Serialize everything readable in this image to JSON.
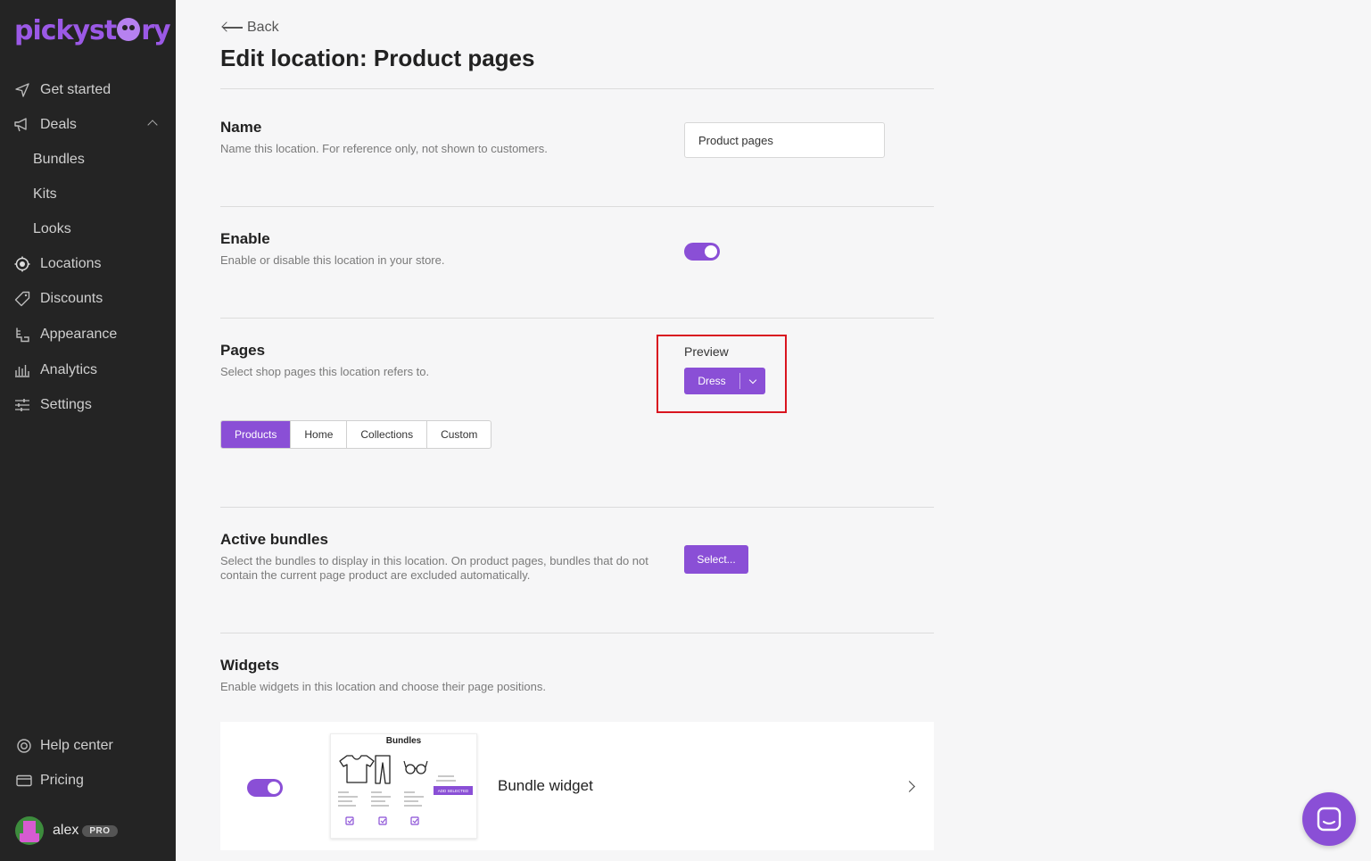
{
  "brand": {
    "logo_text_before": "pickyst",
    "logo_text_after": "ry",
    "accent": "#8a4fd6"
  },
  "sidebar": {
    "items": [
      {
        "label": "Get started",
        "icon": "send-icon"
      },
      {
        "label": "Deals",
        "icon": "megaphone-icon"
      },
      {
        "label": "Bundles"
      },
      {
        "label": "Kits"
      },
      {
        "label": "Looks"
      },
      {
        "label": "Locations",
        "icon": "target-icon"
      },
      {
        "label": "Discounts",
        "icon": "tag-icon"
      },
      {
        "label": "Appearance",
        "icon": "paint-roller-icon"
      },
      {
        "label": "Analytics",
        "icon": "bar-chart-icon"
      },
      {
        "label": "Settings",
        "icon": "sliders-icon"
      }
    ],
    "bottom": [
      {
        "label": "Help center",
        "icon": "lifebuoy-icon"
      },
      {
        "label": "Pricing",
        "icon": "credit-card-icon"
      }
    ],
    "user": {
      "name": "alex",
      "badge": "PRO"
    }
  },
  "header": {
    "back_label": "Back",
    "title": "Edit location: Product pages"
  },
  "name_section": {
    "title": "Name",
    "desc": "Name this location. For reference only, not shown to customers.",
    "value": "Product pages"
  },
  "enable_section": {
    "title": "Enable",
    "desc": "Enable or disable this location in your store.",
    "enabled": true
  },
  "pages_section": {
    "title": "Pages",
    "desc": "Select shop pages this location refers to.",
    "preview_label": "Preview",
    "preview_value": "Dress",
    "tabs": [
      "Products",
      "Home",
      "Collections",
      "Custom"
    ],
    "active_tab": "Products"
  },
  "bundles_section": {
    "title": "Active bundles",
    "desc": "Select the bundles to display in this location. On product pages, bundles that do not contain the current page product are excluded automatically.",
    "button": "Select..."
  },
  "widgets_section": {
    "title": "Widgets",
    "desc": "Enable widgets in this location and choose their page positions.",
    "widget": {
      "name": "Bundle widget",
      "enabled": true,
      "thumb_title": "Bundles",
      "thumb_button": "ADD SELECTED"
    }
  }
}
